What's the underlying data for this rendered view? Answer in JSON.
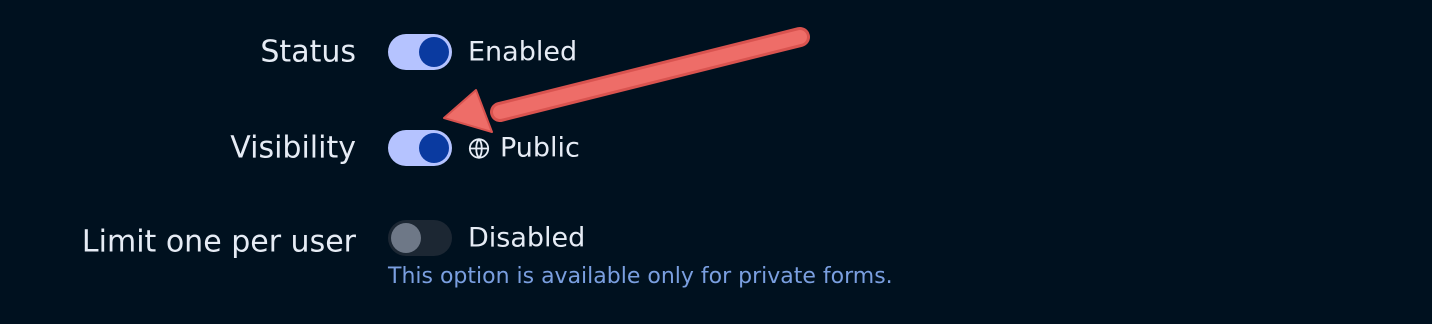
{
  "settings": {
    "status": {
      "label": "Status",
      "value": "Enabled",
      "enabled": true
    },
    "visibility": {
      "label": "Visibility",
      "value": "Public",
      "enabled": true,
      "icon": "globe-icon"
    },
    "limit": {
      "label": "Limit one per user",
      "value": "Disabled",
      "enabled": false,
      "helper": "This option is available only for private forms."
    }
  },
  "colors": {
    "background": "#00111f",
    "toggle_on_track": "#b5c3ff",
    "toggle_on_knob": "#0a3aa0",
    "toggle_off_track": "#1c2733",
    "toggle_off_knob": "#6e7887",
    "helper_text": "#7a9fe0",
    "annotation_arrow": "#ee6d68"
  }
}
